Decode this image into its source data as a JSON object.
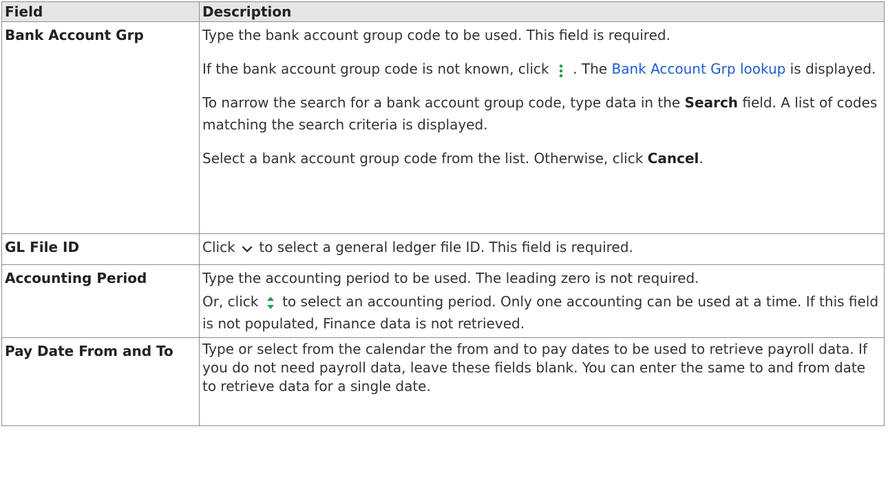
{
  "table": {
    "headers": {
      "field": "Field",
      "description": "Description"
    },
    "rows": [
      {
        "field": "Bank Account Grp",
        "p1": "Type the bank account group code to be used. This field is required.",
        "p2_a": "If the bank account group code is not known, click ",
        "p2_b": " . The ",
        "p2_link": "Bank Account Grp lookup",
        "p2_c": " is displayed.",
        "p3_a": "To narrow the search for a bank account group code, type data in the ",
        "p3_bold": "Search",
        "p3_b": " field. A list of codes matching the search criteria is displayed.",
        "p4_a": "Select a bank account group code from the list. Otherwise, click ",
        "p4_bold": "Cancel",
        "p4_b": "."
      },
      {
        "field": "GL File ID",
        "p1_a": "Click ",
        "p1_b": " to select a general ledger file ID. This field is required."
      },
      {
        "field": "Accounting Period",
        "p1": "Type the accounting period to be used. The leading zero is not required.",
        "p2_a": "Or, click ",
        "p2_b": " to select an accounting period. Only one accounting can be used at a time. If this field is not populated, Finance data is not retrieved."
      },
      {
        "field": "Pay Date From and To",
        "p1": "Type or select from the calendar the from and to pay dates to be used to retrieve payroll data. If you do not need payroll data, leave these fields blank. You can enter the same to and from date to retrieve data for a single date."
      }
    ]
  },
  "icons": {
    "lookup": "vertical-ellipsis-icon",
    "dropdown": "chevron-down-icon",
    "spinner": "up-down-arrows-icon"
  },
  "colors": {
    "icon_green": "#1f9e4a",
    "link": "#1d5bd6"
  }
}
